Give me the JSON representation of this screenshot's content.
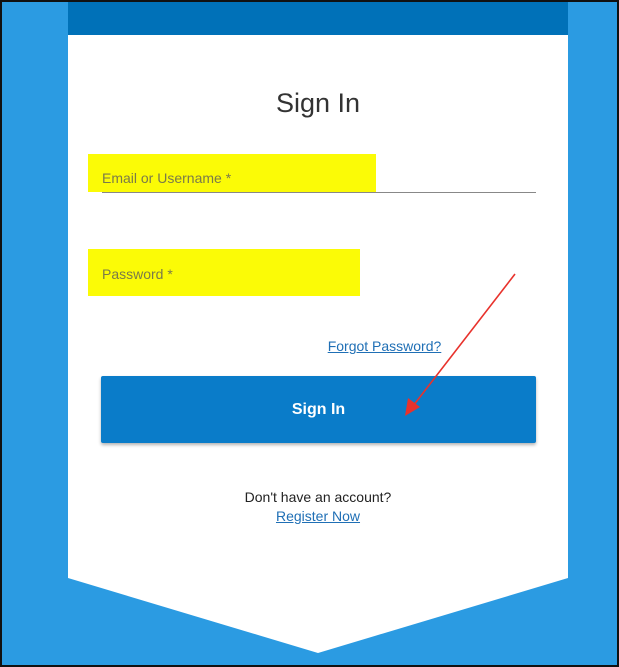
{
  "form": {
    "title": "Sign In",
    "email_placeholder": "Email or Username *",
    "password_placeholder": "Password *",
    "forgot_label": "Forgot Password?",
    "submit_label": "Sign In",
    "no_account_text": "Don't have an account?",
    "register_label": "Register Now"
  },
  "colors": {
    "background": "#2b9be2",
    "card": "#ffffff",
    "top_bar": "#0071b8",
    "button": "#0a7cc9",
    "highlight": "#fbfb06",
    "annotation_arrow": "#e8322c"
  }
}
